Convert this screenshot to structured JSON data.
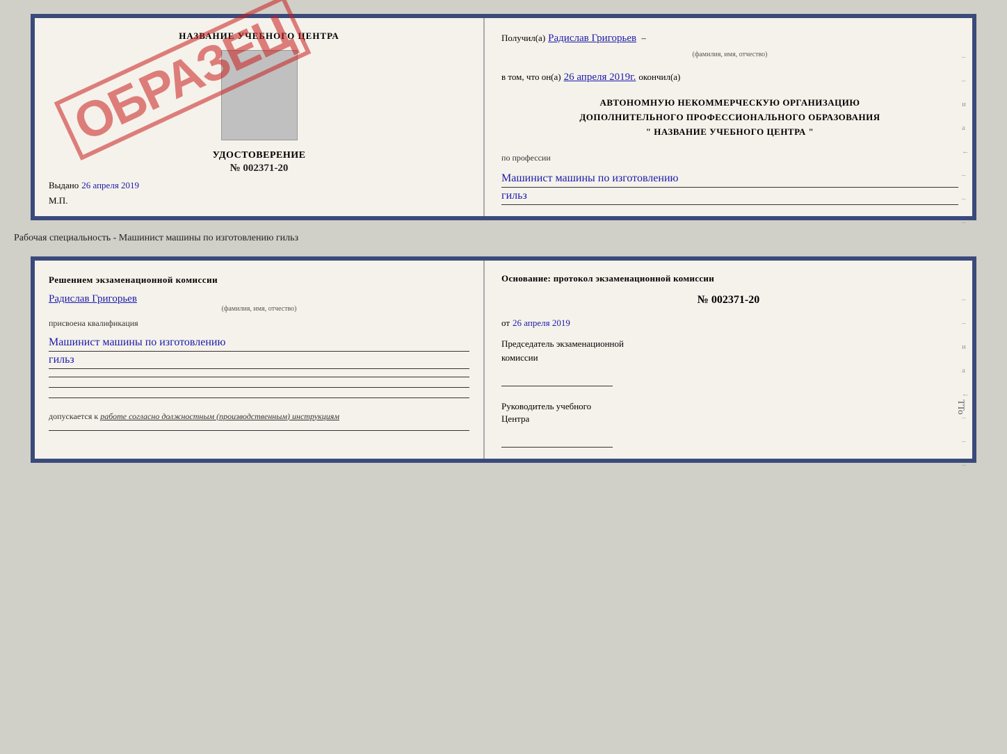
{
  "top_doc": {
    "left": {
      "header": "НАЗВАНИЕ УЧЕБНОГО ЦЕНТРА",
      "cert_title": "УДОСТОВЕРЕНИЕ",
      "cert_number": "№ 002371-20",
      "stamp": "ОБРАЗЕЦ",
      "vydano_label": "Выдано",
      "vydano_date": "26 апреля 2019",
      "mp": "М.П."
    },
    "right": {
      "poluchil_prefix": "Получил(а)",
      "fio": "Радислав Григорьев",
      "fio_hint": "(фамилия, имя, отчество)",
      "v_tom_prefix": "в том, что он(а)",
      "date_val": "26 апреля 2019г.",
      "okonchil": "окончил(а)",
      "org_line1": "АВТОНОМНУЮ НЕКОММЕРЧЕСКУЮ ОРГАНИЗАЦИЮ",
      "org_line2": "ДОПОЛНИТЕЛЬНОГО ПРОФЕССИОНАЛЬНОГО ОБРАЗОВАНИЯ",
      "org_quote": "\" НАЗВАНИЕ УЧЕБНОГО ЦЕНТРА \"",
      "po_professii": "по профессии",
      "profession1": "Машинист машины по изготовлению",
      "profession2": "гильз"
    }
  },
  "separator": {
    "text": "Рабочая специальность - Машинист машины по изготовлению гильз"
  },
  "bottom_doc": {
    "left": {
      "resheniyem": "Решением экзаменационной комиссии",
      "fio": "Радислав Григорьев",
      "fio_hint": "(фамилия, имя, отчество)",
      "prisvoena": "присвоена квалификация",
      "qualification1": "Машинист машины по изготовлению",
      "qualification2": "гильз",
      "dopuskaetsya": "допускается к",
      "rabota_text": "работе согласно должностным (производственным) инструкциям"
    },
    "right": {
      "osnovanie": "Основание: протокол экзаменационной комиссии",
      "number": "№ 002371-20",
      "ot_prefix": "от",
      "ot_date": "26 апреля 2019",
      "predsedatel_line1": "Председатель экзаменационной",
      "predsedatel_line2": "комиссии",
      "rukovoditel_line1": "Руководитель учебного",
      "rukovoditel_line2": "Центра"
    }
  },
  "side_chars": [
    "и",
    "а",
    "←",
    "–",
    "–",
    "–"
  ]
}
